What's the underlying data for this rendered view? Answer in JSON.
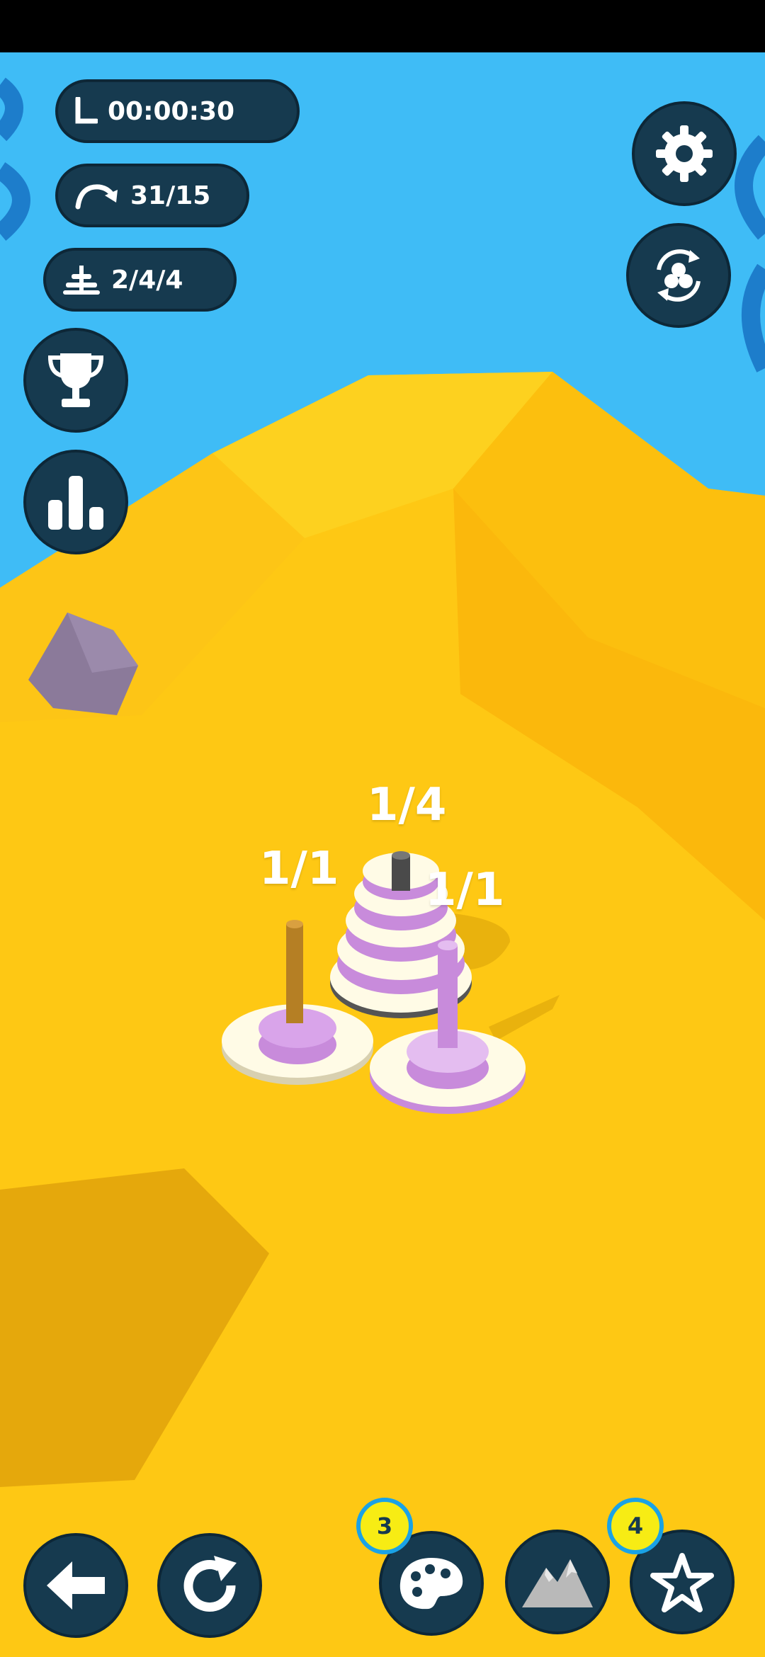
{
  "hud": {
    "timer": "00:00:30",
    "moves": "31/15",
    "discs": "2/4/4"
  },
  "pegs": {
    "left_label": "1/1",
    "middle_label": "1/4",
    "right_label": "1/1"
  },
  "bottom_bar": {
    "palette_badge": "3",
    "star_badge": "4"
  },
  "colors": {
    "sky": "#3fbcf6",
    "sand": "#fec814",
    "button_bg": "#163a4f",
    "disc": "#c88bdb",
    "badge": "#f7ec14"
  },
  "icons": [
    "timer-icon",
    "moves-icon",
    "discs-icon",
    "gear-icon",
    "shuffle-icon",
    "trophy-icon",
    "stats-icon",
    "back-arrow-icon",
    "restart-icon",
    "palette-icon",
    "mountain-icon",
    "star-icon"
  ]
}
